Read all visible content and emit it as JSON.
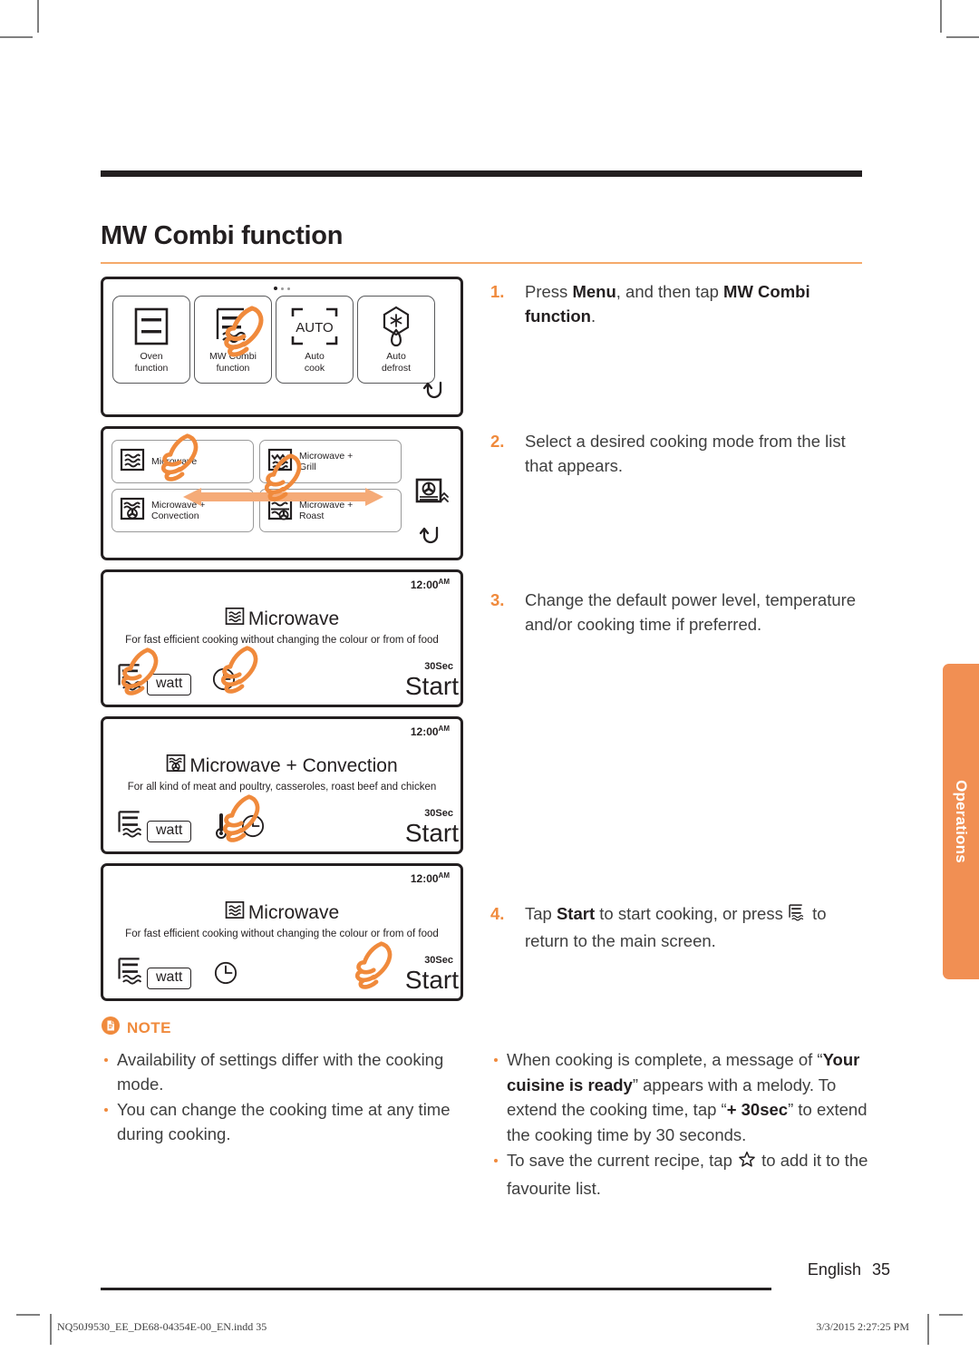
{
  "header": {
    "title": "MW Combi function"
  },
  "illustrations": {
    "panel1": {
      "name": "menu-screen",
      "tiles": [
        {
          "icon": "oven-function-icon",
          "caption_line1": "Oven",
          "caption_line2": "function"
        },
        {
          "icon": "mw-combi-function-icon",
          "caption_line1": "MW Combi",
          "caption_line2": "function"
        },
        {
          "icon": "auto-cook-icon",
          "caption_line1": "Auto",
          "caption_line2": "cook",
          "glyph_text": "AUTO"
        },
        {
          "icon": "auto-defrost-icon",
          "caption_line1": "Auto",
          "caption_line2": "defrost"
        }
      ],
      "back_icon": "return-arrow-icon"
    },
    "panel2": {
      "name": "cooking-mode-list-screen",
      "modes": [
        {
          "icon": "microwave-icon",
          "label": "Microwave"
        },
        {
          "icon": "microwave-grill-icon",
          "label_line1": "Microwave +",
          "label_line2": "Grill"
        },
        {
          "icon": "microwave-convection-icon",
          "label_line1": "Microwave +",
          "label_line2": "Convection"
        },
        {
          "icon": "microwave-roast-icon",
          "label_line1": "Microwave +",
          "label_line2": "Roast"
        }
      ],
      "side_icon": "convection-next-page-icon",
      "back_icon": "return-arrow-icon"
    },
    "panel3": {
      "name": "microwave-setting-screen",
      "time": "12:00",
      "time_suffix": "AM",
      "title": "Microwave",
      "title_icon": "microwave-icon",
      "description_line1": "For fast efficient cooking without changing the colour or",
      "description_line2": "from of food",
      "watt_label": "watt",
      "clock_icon": "clock-icon",
      "home_icon": "home-microwave-icon",
      "plus30_label": "30Sec",
      "start_label": "Start"
    },
    "panel4": {
      "name": "microwave-convection-setting-screen",
      "time": "12:00",
      "time_suffix": "AM",
      "title": "Microwave + Convection",
      "title_icon": "microwave-convection-icon",
      "description_line1": "For all kind of meat and poultry, casseroles, roast beef",
      "description_line2": "and chicken",
      "watt_label": "watt",
      "temp_icon": "thermometer-icon",
      "clock_icon": "clock-icon",
      "home_icon": "home-microwave-icon",
      "plus30_label": "30Sec",
      "start_label": "Start"
    },
    "panel5": {
      "name": "microwave-start-screen",
      "time": "12:00",
      "time_suffix": "AM",
      "title": "Microwave",
      "title_icon": "microwave-icon",
      "description_line1": "For fast efficient cooking without changing the colour or",
      "description_line2": "from of food",
      "watt_label": "watt",
      "clock_icon": "clock-icon",
      "home_icon": "home-microwave-icon",
      "plus30_label": "30Sec",
      "start_label": "Start"
    }
  },
  "steps": [
    {
      "number": "1.",
      "text_plain_a": "Press ",
      "bold_a": "Menu",
      "text_plain_b": ", and then tap ",
      "bold_b": "MW Combi function",
      "text_plain_c": "."
    },
    {
      "number": "2.",
      "text": "Select a desired cooking mode from the list that appears."
    },
    {
      "number": "3.",
      "text": "Change the default power level, temperature and/or cooking time if preferred."
    },
    {
      "number": "4.",
      "text_plain_a": "Tap ",
      "bold_a": "Start",
      "text_plain_b": " to start cooking, or press ",
      "icon": "home-microwave-icon",
      "text_plain_c": " to return to the main screen."
    }
  ],
  "note": {
    "icon": "note-document-icon",
    "heading": "NOTE",
    "bullets": [
      "Availability of settings differ with the cooking mode.",
      "You can change the cooking time at any time during cooking."
    ]
  },
  "tail_bullets": [
    {
      "a": "When cooking is complete, a message of “",
      "b1": "Your cuisine is ready",
      "c": "” appears with a melody. To extend the cooking time, tap “",
      "b2": "+ 30sec",
      "d": "” to extend the cooking time by 30 seconds."
    },
    {
      "a": "To save the current recipe, tap ",
      "icon": "star-favourite-icon",
      "d": " to add it to the favourite list."
    }
  ],
  "side_tab": {
    "label": "Operations"
  },
  "footer": {
    "language": "English",
    "page_number": "35",
    "print_file": "NQ50J9530_EE_DE68-04354E-00_EN.indd   35",
    "print_timestamp": "3/3/2015   2:27:25 PM"
  },
  "colors": {
    "accent_orange": "#f08a3c",
    "tab_orange": "#f18f53",
    "title_rule": "#f5a96a",
    "ink": "#231f20",
    "body_text": "#3f3f3f"
  }
}
